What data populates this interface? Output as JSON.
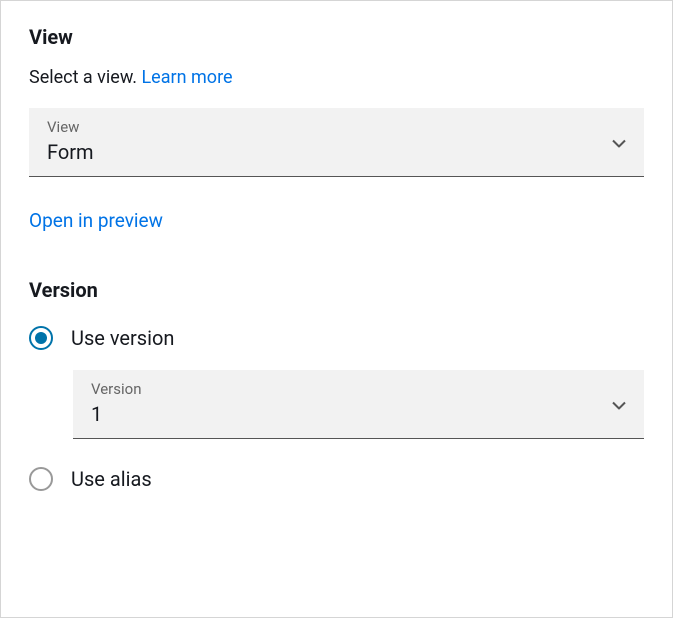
{
  "view_section": {
    "heading": "View",
    "helper_text": "Select a view. ",
    "learn_more": "Learn more",
    "select": {
      "label": "View",
      "value": "Form"
    },
    "preview_link": "Open in preview"
  },
  "version_section": {
    "heading": "Version",
    "option_use_version": "Use version",
    "option_use_alias": "Use alias",
    "selected": "use_version",
    "version_select": {
      "label": "Version",
      "value": "1"
    }
  }
}
